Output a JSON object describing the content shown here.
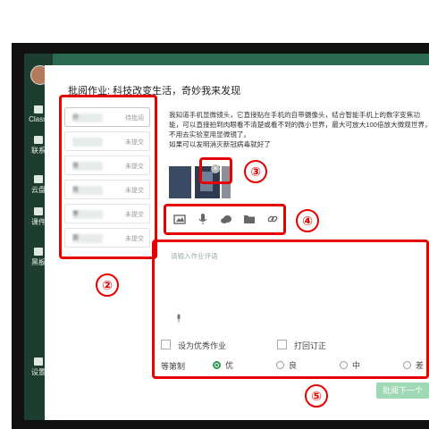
{
  "rail": {
    "items": [
      {
        "label": "Classi",
        "icon": "home-icon"
      },
      {
        "label": "联系",
        "icon": "contacts-icon"
      },
      {
        "label": "云盘",
        "icon": "cloud-icon"
      },
      {
        "label": "课件",
        "icon": "courseware-icon"
      },
      {
        "label": "黑板",
        "icon": "blackboard-icon"
      },
      {
        "label": "设置",
        "icon": "settings-icon"
      }
    ]
  },
  "dialog": {
    "title": "批阅作业:  科技改变生活，奇妙我来发现"
  },
  "students": [
    {
      "name": "孙",
      "status": "待批阅"
    },
    {
      "name": "",
      "status": "未提交"
    },
    {
      "name": "张",
      "status": "未提交"
    },
    {
      "name": "肖",
      "status": "未提交"
    },
    {
      "name": "李",
      "status": "未提交"
    },
    {
      "name": "郭",
      "status": "未提交"
    }
  ],
  "homework": {
    "text": "我知道手机显微镜头，它直接贴在手机的自带摄像头，结合智能手机上的数字变焦功能，可以直接拍到肉眼看不清楚或看不到的微小世界，最大可放大100倍放大微观世界，不用去实验室用显微镜了。\n如果可以发明消灭新冠病毒就好了"
  },
  "toolbar": {
    "icons": [
      "image-icon",
      "microphone-icon",
      "cloud-icon",
      "folder-icon",
      "link-icon"
    ]
  },
  "comment": {
    "placeholder": "请输入作业评语"
  },
  "options": {
    "excellent_label": "设为优秀作业",
    "return_label": "打回订正"
  },
  "grading": {
    "label": "等第制",
    "choices": [
      "优",
      "良",
      "中",
      "差"
    ],
    "selected": "优"
  },
  "next_button": "批阅下一个",
  "annotations": [
    "②",
    "③",
    "④",
    "⑤"
  ],
  "colors": {
    "annotation_red": "#e60000",
    "accent_green": "#2b9b50",
    "button_disabled_green": "#9fd8b4",
    "app_background": "#2a6b52"
  }
}
